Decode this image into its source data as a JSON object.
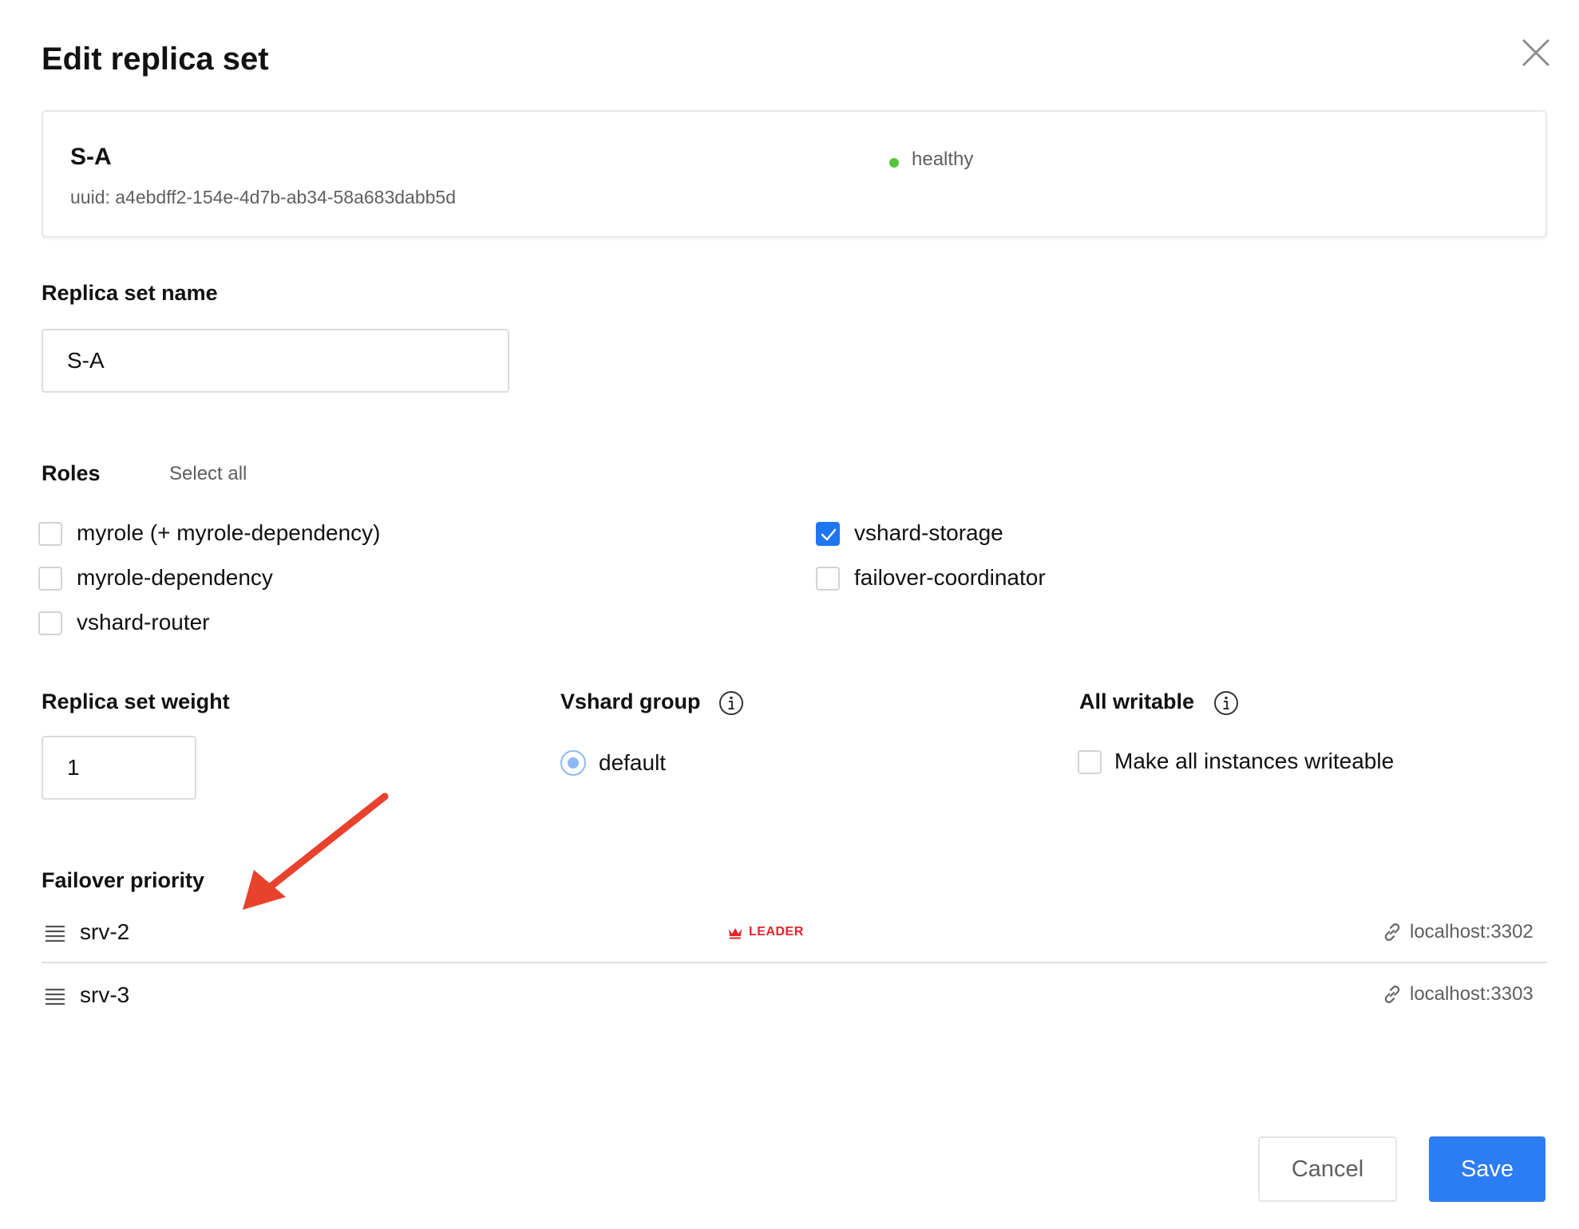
{
  "dialog": {
    "title": "Edit replica set"
  },
  "summary": {
    "name": "S-A",
    "uuid": "uuid: a4ebdff2-154e-4d7b-ab34-58a683dabb5d",
    "status": "healthy",
    "status_color": "#5ac43c"
  },
  "replica_set_name": {
    "label": "Replica set name",
    "value": "S-A"
  },
  "roles": {
    "label": "Roles",
    "select_all": "Select all",
    "items": [
      {
        "label": "myrole (+ myrole-dependency)",
        "checked": false
      },
      {
        "label": "myrole-dependency",
        "checked": false
      },
      {
        "label": "vshard-router",
        "checked": false
      },
      {
        "label": "vshard-storage",
        "checked": true
      },
      {
        "label": "failover-coordinator",
        "checked": false
      }
    ]
  },
  "weight": {
    "label": "Replica set weight",
    "value": "1"
  },
  "vshard_group": {
    "label": "Vshard group",
    "options": [
      {
        "label": "default",
        "selected": true
      }
    ]
  },
  "all_writable": {
    "label": "All writable",
    "checkbox_label": "Make all instances writeable",
    "checked": false
  },
  "failover_priority": {
    "label": "Failover priority",
    "servers": [
      {
        "name": "srv-2",
        "badge": "LEADER",
        "uri": "localhost:3302"
      },
      {
        "name": "srv-3",
        "badge": "",
        "uri": "localhost:3303"
      }
    ]
  },
  "buttons": {
    "cancel": "Cancel",
    "save": "Save"
  },
  "colors": {
    "accent": "#2c7cf4",
    "leader": "#e3252b",
    "annotation_arrow": "#e8412c"
  },
  "icons": [
    "close-icon",
    "check-icon",
    "info-icon",
    "drag-handle-icon",
    "crown-icon",
    "link-icon",
    "arrow-annotation"
  ]
}
